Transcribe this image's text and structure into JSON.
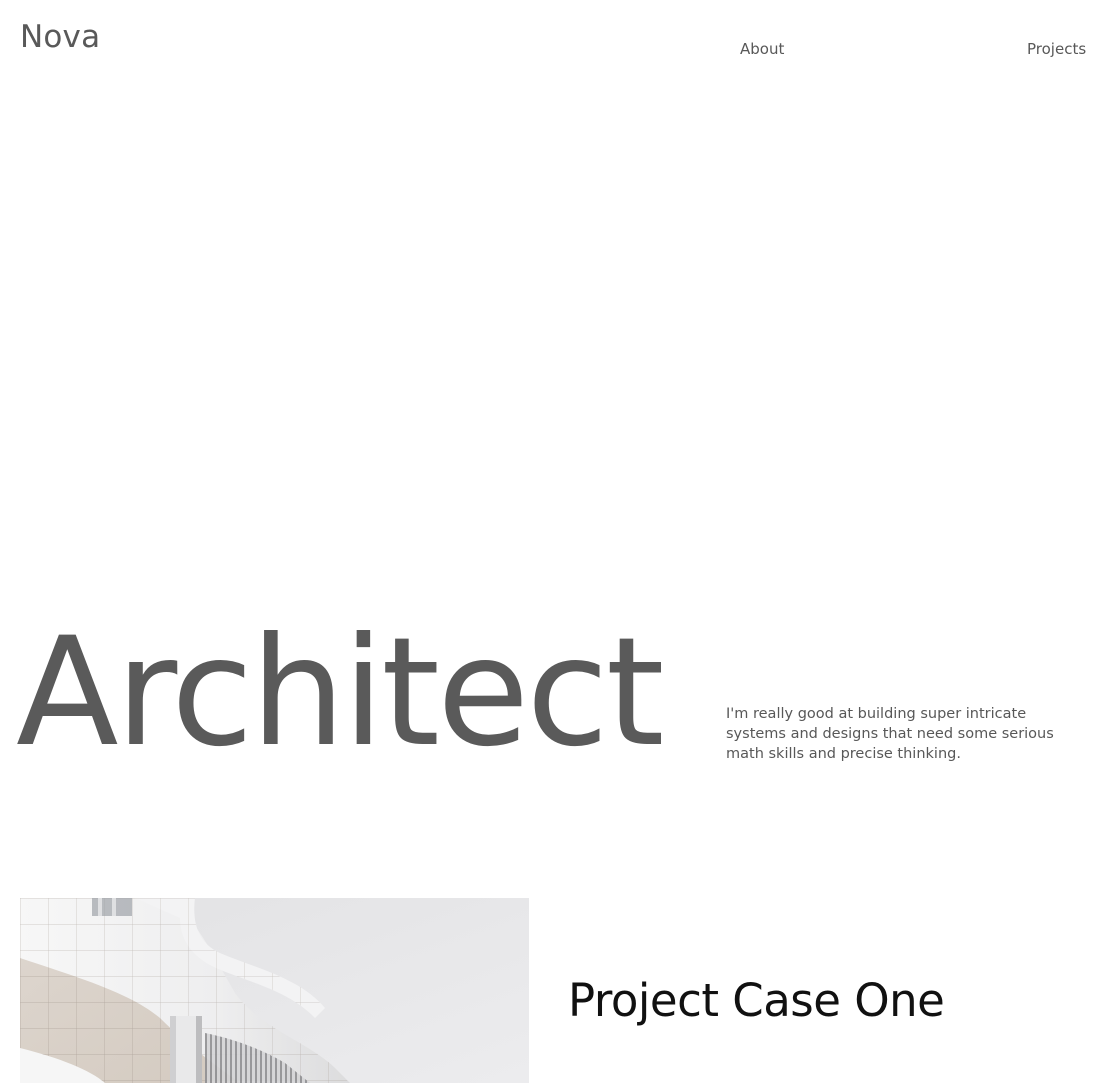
{
  "header": {
    "logo": "Nova",
    "nav": {
      "about": "About",
      "projects": "Projects"
    }
  },
  "hero": {
    "title": "Architect",
    "description": "I'm really good at building super intricate systems and designs that need some serious math skills and precise thinking."
  },
  "projects": [
    {
      "title": "Project Case One",
      "image_icon": "architecture-photo"
    }
  ],
  "colors": {
    "background": "#ffffff",
    "text_primary": "#585858",
    "project_title": "#111111"
  }
}
